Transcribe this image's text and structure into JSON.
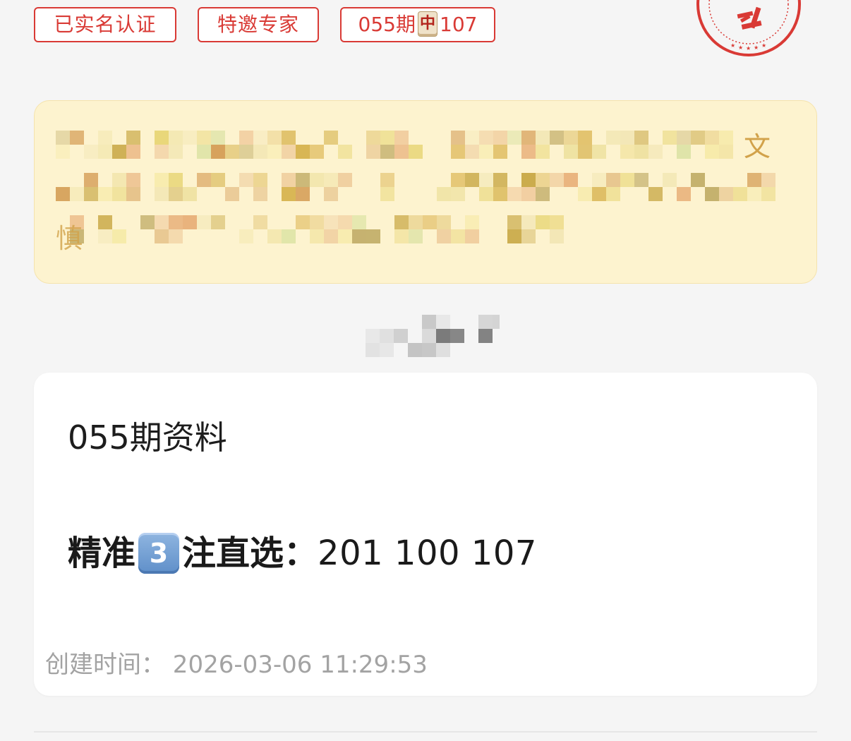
{
  "tags": [
    {
      "label": "已实名认证"
    },
    {
      "label": "特邀专家"
    },
    {
      "prefix": "055期",
      "tile": "中",
      "suffix": "107"
    }
  ],
  "notice": {
    "visible_chars": [
      "文",
      "慎"
    ]
  },
  "card": {
    "title": "055期资料",
    "line_prefix": "精准",
    "keycap": "3",
    "line_suffix": "注直选：",
    "numbers": "201 100 107",
    "created_at": "创建时间：  2026-03-06 11:29:53"
  },
  "colors": {
    "accent_red": "#d93a35",
    "notice_bg": "#fdf3cf",
    "page_bg": "#f5f5f5",
    "keycap_blue": "#6b98cf"
  },
  "icons": {
    "tag_tile": "mahjong-zhong-tile-icon",
    "stamp": "certification-stamp-icon"
  }
}
